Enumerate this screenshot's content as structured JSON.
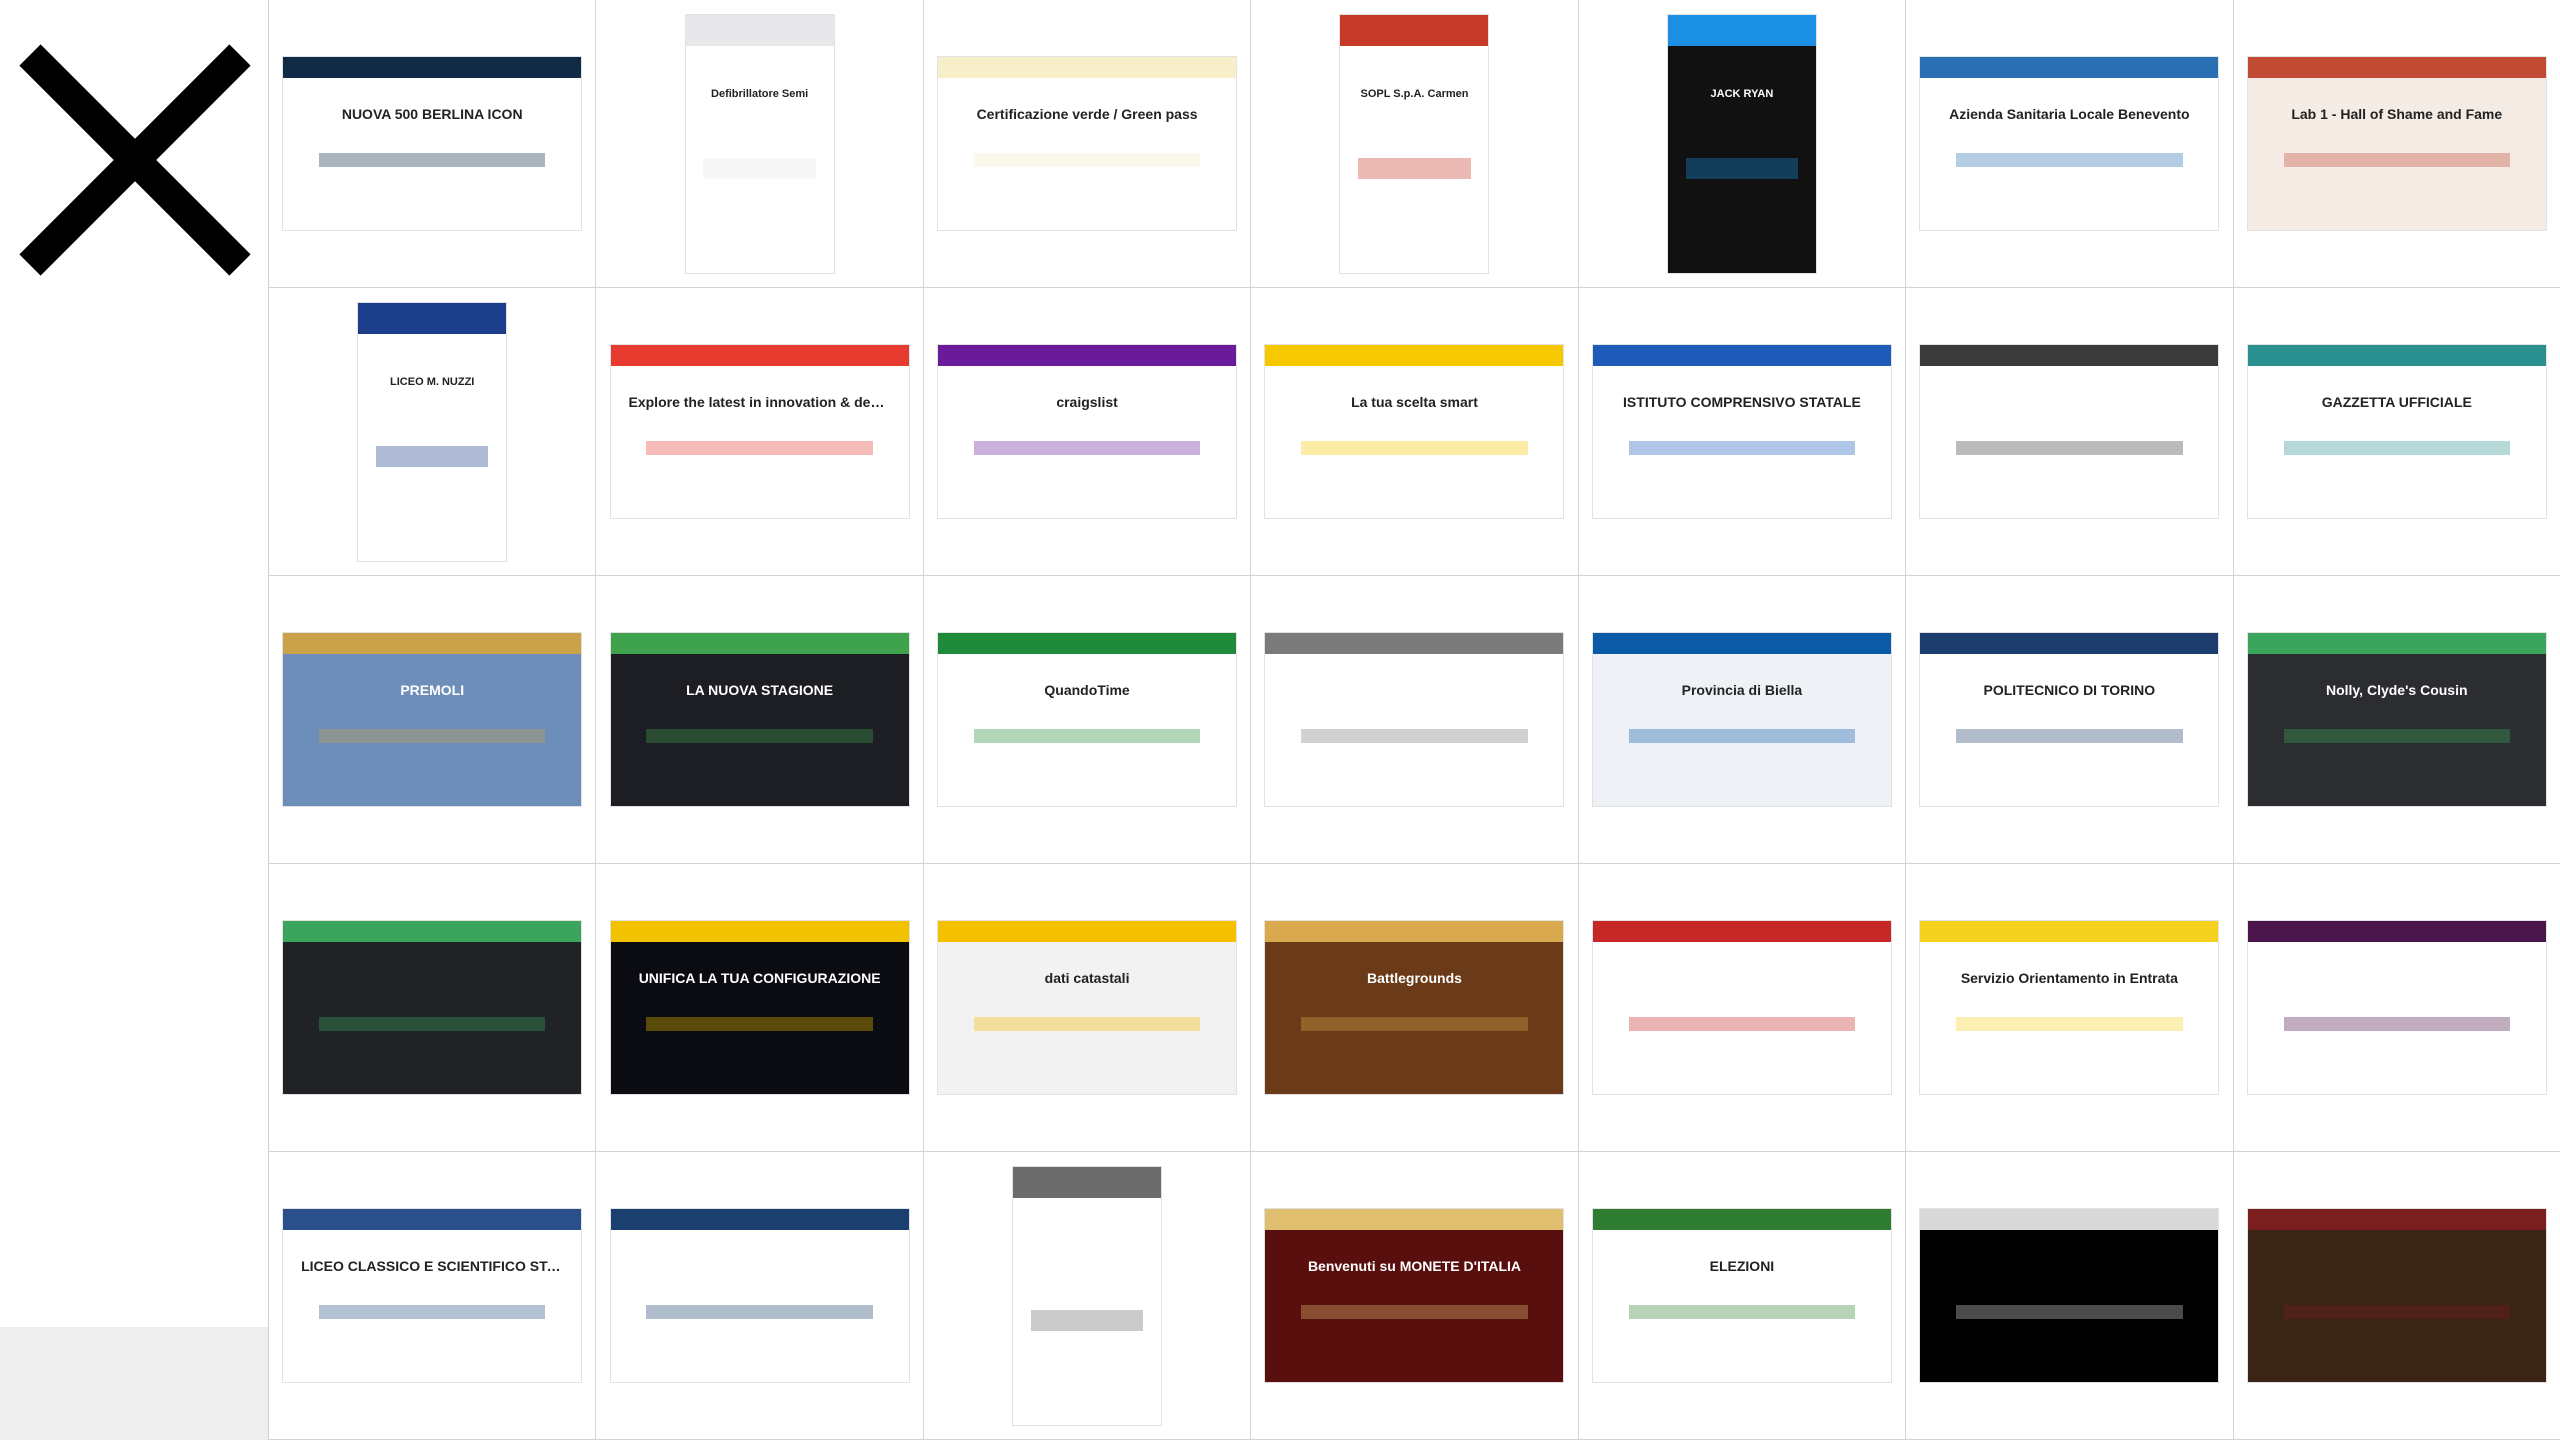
{
  "close": {
    "icon": "close-x-icon"
  },
  "thumbnails": [
    {
      "label": "NUOVA 500 BERLINA ICON",
      "bg": "#ffffff",
      "accent": "#0f2b46",
      "aspect": "wide"
    },
    {
      "label": "Defibrillatore Semi",
      "bg": "#ffffff",
      "accent": "#e8e8ea",
      "aspect": "portrait"
    },
    {
      "label": "Certificazione verde / Green pass",
      "bg": "#ffffff",
      "accent": "#f6efc9",
      "aspect": "wide"
    },
    {
      "label": "SOPL S.p.A. Carmen",
      "bg": "#ffffff",
      "accent": "#c63a2a",
      "aspect": "portrait"
    },
    {
      "label": "JACK RYAN",
      "bg": "#111111",
      "accent": "#1a8fe3",
      "aspect": "portrait"
    },
    {
      "label": "Azienda Sanitaria Locale Benevento",
      "bg": "#ffffff",
      "accent": "#2b6fb3",
      "aspect": "wide"
    },
    {
      "label": "Lab 1 - Hall of Shame and Fame",
      "bg": "#f4ebe4",
      "accent": "#c04a33",
      "aspect": "wide"
    },
    {
      "label": "LICEO M. NUZZI",
      "bg": "#ffffff",
      "accent": "#1b3d8a",
      "aspect": "portrait"
    },
    {
      "label": "Explore the latest in innovation & design",
      "bg": "#ffffff",
      "accent": "#e63b2e",
      "aspect": "wide"
    },
    {
      "label": "craigslist",
      "bg": "#ffffff",
      "accent": "#6a1b9a",
      "aspect": "wide"
    },
    {
      "label": "La tua scelta smart",
      "bg": "#ffffff",
      "accent": "#f5c800",
      "aspect": "wide"
    },
    {
      "label": "ISTITUTO COMPRENSIVO STATALE",
      "bg": "#ffffff",
      "accent": "#1e5bb8",
      "aspect": "wide"
    },
    {
      "label": "",
      "bg": "#ffffff",
      "accent": "#3a3a3a",
      "aspect": "wide"
    },
    {
      "label": "GAZZETTA UFFICIALE",
      "bg": "#ffffff",
      "accent": "#2a8f8f",
      "aspect": "wide"
    },
    {
      "label": "PREMOLI",
      "bg": "#6d8eb8",
      "accent": "#c9a24a",
      "aspect": "wide"
    },
    {
      "label": "LA NUOVA STAGIONE",
      "bg": "#1d1d24",
      "accent": "#3fa34d",
      "aspect": "wide"
    },
    {
      "label": "QuandoTime",
      "bg": "#ffffff",
      "accent": "#1f8a3a",
      "aspect": "wide"
    },
    {
      "label": "",
      "bg": "#ffffff",
      "accent": "#7a7a7a",
      "aspect": "wide"
    },
    {
      "label": "Provincia di Biella",
      "bg": "#eef2f7",
      "accent": "#0b5aa8",
      "aspect": "wide"
    },
    {
      "label": "POLITECNICO DI TORINO",
      "bg": "#ffffff",
      "accent": "#1d3c6e",
      "aspect": "wide"
    },
    {
      "label": "Nolly, Clyde's Cousin",
      "bg": "#2b2d31",
      "accent": "#3ba55d",
      "aspect": "wide"
    },
    {
      "label": "",
      "bg": "#202225",
      "accent": "#3ba55d",
      "aspect": "wide"
    },
    {
      "label": "UNIFICA LA TUA CONFIGURAZIONE",
      "bg": "#0b0b12",
      "accent": "#f2c200",
      "aspect": "wide"
    },
    {
      "label": "dati catastali",
      "bg": "#f2f2f2",
      "accent": "#f5c000",
      "aspect": "wide"
    },
    {
      "label": "Battlegrounds",
      "bg": "#6b3a19",
      "accent": "#d9a94e",
      "aspect": "wide"
    },
    {
      "label": "",
      "bg": "#ffffff",
      "accent": "#c62828",
      "aspect": "wide"
    },
    {
      "label": "Servizio Orientamento in Entrata",
      "bg": "#ffffff",
      "accent": "#f4d21f",
      "aspect": "wide"
    },
    {
      "label": "",
      "bg": "#ffffff",
      "accent": "#4a154b",
      "aspect": "wide"
    },
    {
      "label": "LICEO CLASSICO E SCIENTIFICO STATALE",
      "bg": "#ffffff",
      "accent": "#2b4f8a",
      "aspect": "wide"
    },
    {
      "label": "",
      "bg": "#ffffff",
      "accent": "#1b3f6e",
      "aspect": "wide"
    },
    {
      "label": "",
      "bg": "#ffffff",
      "accent": "#6b6b6b",
      "aspect": "portrait"
    },
    {
      "label": "Benvenuti su MONETE D'ITALIA",
      "bg": "#5a0f0f",
      "accent": "#e0c070",
      "aspect": "wide"
    },
    {
      "label": "ELEZIONI",
      "bg": "#ffffff",
      "accent": "#2e7d32",
      "aspect": "wide"
    },
    {
      "label": "",
      "bg": "#000000",
      "accent": "#d8d8d8",
      "aspect": "wide"
    },
    {
      "label": "",
      "bg": "#3a2416",
      "accent": "#7a1e1e",
      "aspect": "wide"
    }
  ]
}
